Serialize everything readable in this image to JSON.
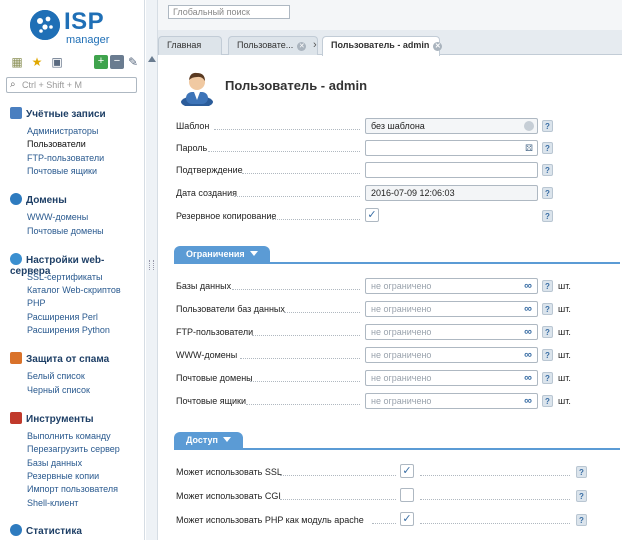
{
  "app": {
    "logo_isp": "ISP",
    "logo_manager": "manager"
  },
  "topbar": {
    "global_search_placeholder": "Глобальный поиск"
  },
  "tabs": [
    {
      "label": "Главная"
    },
    {
      "label": "Пользовате..."
    },
    {
      "label": "Пользователь - admin"
    }
  ],
  "sidebar": {
    "search_placeholder": "Ctrl + Shift + M",
    "groups": [
      {
        "title": "Учётные записи",
        "items": [
          "Администраторы",
          "Пользователи",
          "FTP-пользователи",
          "Почтовые ящики"
        ]
      },
      {
        "title": "Домены",
        "items": [
          "WWW-домены",
          "Почтовые домены"
        ]
      },
      {
        "title": "Настройки web-сервера",
        "items": [
          "SSL-сертификаты",
          "Каталог Web-скриптов",
          "PHP",
          "Расширения Perl",
          "Расширения Python"
        ]
      },
      {
        "title": "Защита от спама",
        "items": [
          "Белый список",
          "Черный список"
        ]
      },
      {
        "title": "Инструменты",
        "items": [
          "Выполнить команду",
          "Перезагрузить сервер",
          "Базы данных",
          "Резервные копии",
          "Импорт пользователя",
          "Shell-клиент"
        ]
      },
      {
        "title": "Статистика",
        "items": []
      }
    ]
  },
  "form": {
    "title": "Пользователь - admin",
    "fields": {
      "template": {
        "label": "Шаблон",
        "value": "без шаблона"
      },
      "password": {
        "label": "Пароль",
        "value": ""
      },
      "confirm": {
        "label": "Подтверждение",
        "value": ""
      },
      "created": {
        "label": "Дата создания",
        "value": "2016-07-09 12:06:03"
      },
      "backup": {
        "label": "Резервное копирование",
        "checked": true
      }
    },
    "limits_section": "Ограничения",
    "limits": [
      {
        "label": "Базы данных",
        "placeholder": "не ограничено",
        "unit": "шт."
      },
      {
        "label": "Пользователи баз данных",
        "placeholder": "не ограничено",
        "unit": "шт."
      },
      {
        "label": "FTP-пользователи",
        "placeholder": "не ограничено",
        "unit": "шт."
      },
      {
        "label": "WWW-домены",
        "placeholder": "не ограничено",
        "unit": "шт."
      },
      {
        "label": "Почтовые домены",
        "placeholder": "не ограничено",
        "unit": "шт."
      },
      {
        "label": "Почтовые ящики",
        "placeholder": "не ограничено",
        "unit": "шт."
      }
    ],
    "access_section": "Доступ",
    "access": [
      {
        "label": "Может использовать SSL",
        "checked": true
      },
      {
        "label": "Может использовать CGI",
        "checked": false
      },
      {
        "label": "Может использовать PHP как модуль apache",
        "checked": true
      }
    ]
  },
  "colors": {
    "accent": "#1f6fb6",
    "section": "#5b9bd5",
    "link": "#2a5a8f"
  }
}
